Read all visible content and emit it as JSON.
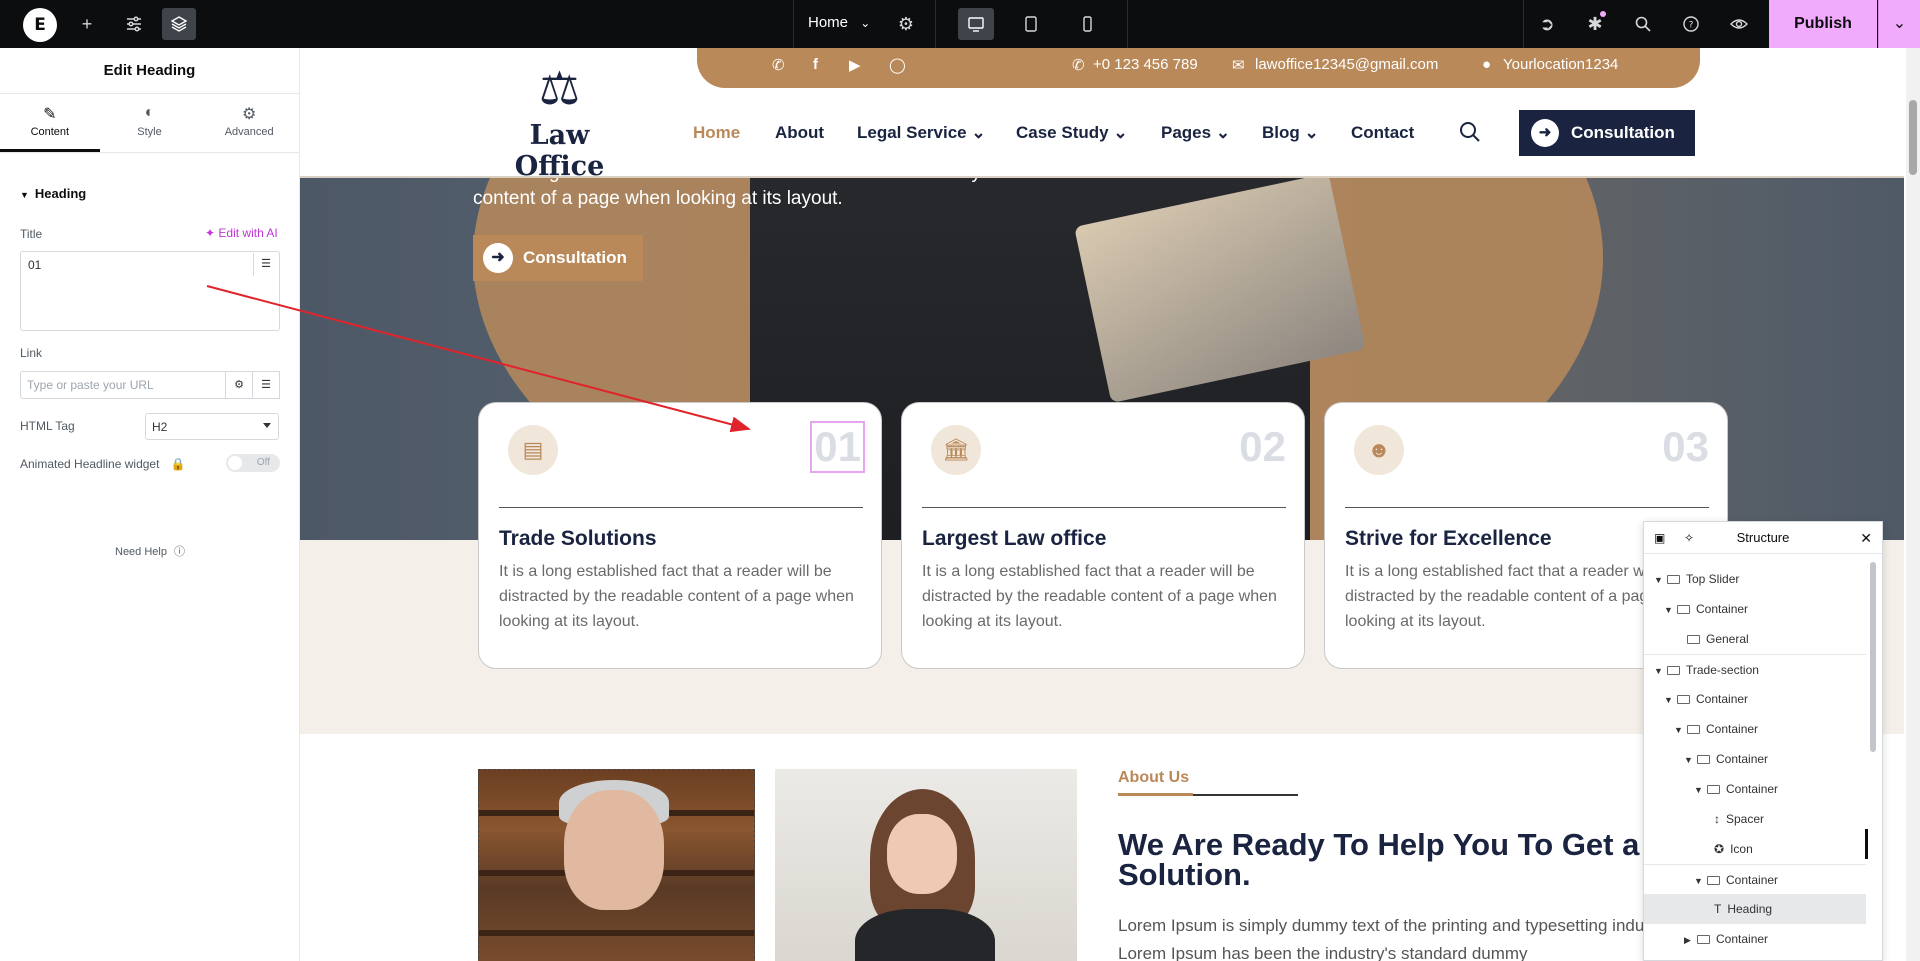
{
  "topbar": {
    "page_name": "Home",
    "publish_label": "Publish"
  },
  "panel": {
    "title": "Edit Heading",
    "tabs": [
      {
        "label": "Content",
        "icon": "pencil-icon"
      },
      {
        "label": "Style",
        "icon": "contrast-icon"
      },
      {
        "label": "Advanced",
        "icon": "gear-icon"
      }
    ],
    "section_heading": "Heading",
    "title_label": "Title",
    "edit_ai_label": "Edit with AI",
    "title_value": "01",
    "link_label": "Link",
    "link_placeholder": "Type or paste your URL",
    "html_tag_label": "HTML Tag",
    "html_tag_value": "H2",
    "animated_label": "Animated Headline widget",
    "toggle_label": "Off",
    "need_help": "Need Help"
  },
  "site": {
    "phone": "+0 123 456 789",
    "email": "lawoffice12345@gmail.com",
    "location": "Yourlocation1234",
    "brand_name": "Law Office",
    "nav": [
      "Home",
      "About",
      "Legal Service",
      "Case Study",
      "Pages",
      "Blog",
      "Contact"
    ],
    "header_cta": "Consultation",
    "hero_text": "It is a long established fact that a reader will be distracted by the readable content of a page when looking at its layout.",
    "hero_cta": "Consultation",
    "cards": [
      {
        "num": "01",
        "title": "Trade Solutions",
        "text": "It is a long established fact that a reader will be distracted by the readable content of a page when looking at its layout."
      },
      {
        "num": "02",
        "title": "Largest Law office",
        "text": "It is a long established fact that a reader will be distracted by the readable content of a page when looking at its layout."
      },
      {
        "num": "03",
        "title": "Strive for Excellence",
        "text": "It is a long established fact that a reader will be distracted by the readable content of a page when looking at its layout."
      }
    ],
    "about_label": "About Us",
    "about_heading": "We Are Ready To Help You To Get a Solution.",
    "about_text": "Lorem Ipsum is simply dummy text of the printing and typesetting industry. Lorem Ipsum has been the industry's standard dummy"
  },
  "structure": {
    "title": "Structure",
    "rows": [
      {
        "label": "Top Slider"
      },
      {
        "label": "Container"
      },
      {
        "label": "General"
      },
      {
        "label": "Trade-section"
      },
      {
        "label": "Container"
      },
      {
        "label": "Container"
      },
      {
        "label": "Container"
      },
      {
        "label": "Container"
      },
      {
        "label": "Spacer"
      },
      {
        "label": "Icon"
      },
      {
        "label": "Container"
      },
      {
        "label": "Heading"
      },
      {
        "label": "Container"
      }
    ]
  },
  "colors": {
    "accent_pink": "#f0abfc",
    "brand_gold": "#b9895a",
    "brand_navy": "#1a2440"
  }
}
